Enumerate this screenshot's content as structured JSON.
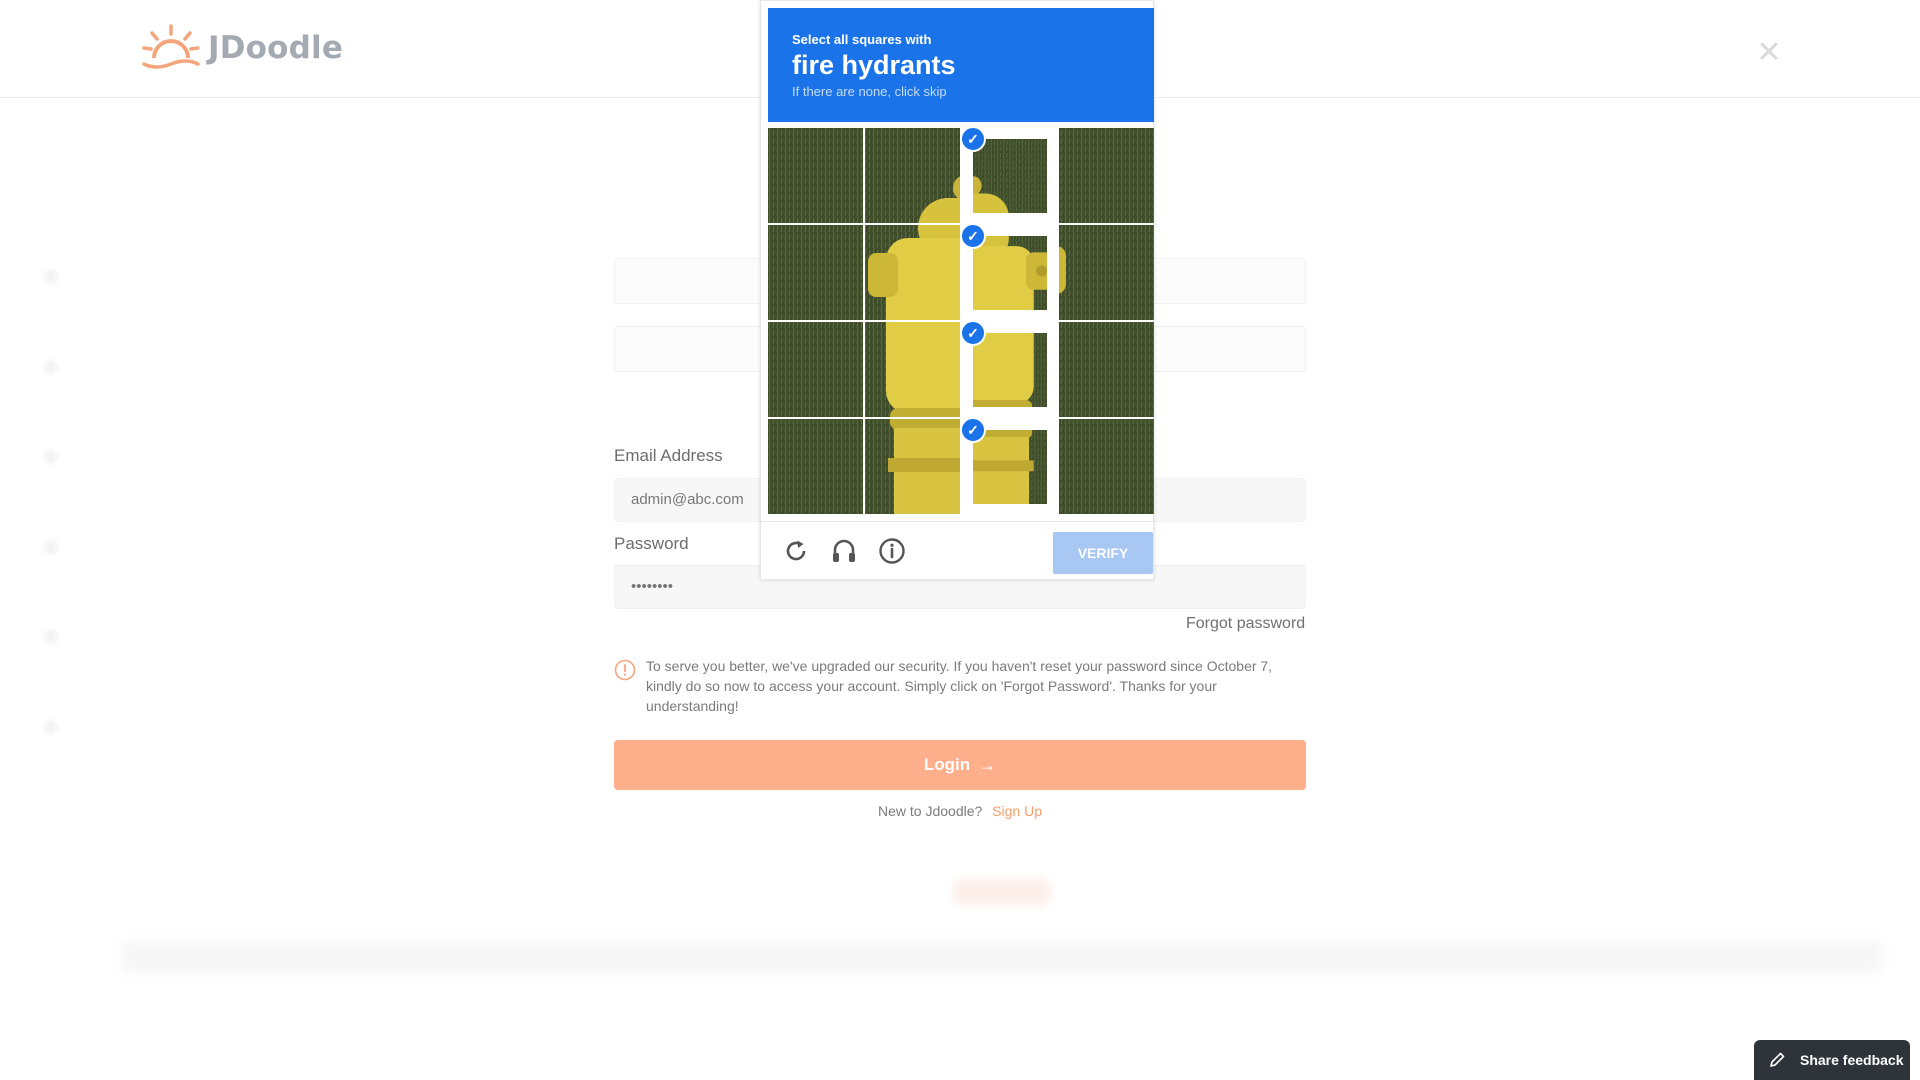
{
  "header": {
    "brand": "JDoodle",
    "close_icon": "close-icon"
  },
  "form": {
    "email_label": "Email Address",
    "email_value": "admin@abc.com",
    "password_label": "Password",
    "password_value": "••••••••",
    "forgot_link": "Forgot password",
    "notice_text": "To serve you better, we've upgraded our security. If you haven't reset your password since October 7, kindly do so now to access your account. Simply click on 'Forgot Password'. Thanks for your understanding!",
    "login_label": "Login",
    "signup_prompt": "New to Jdoodle?",
    "signup_link": "Sign Up"
  },
  "captcha": {
    "instruction": "Select all squares with",
    "target": "fire hydrants",
    "hint": "If there are none, click skip",
    "grid_size": 4,
    "selected_tiles": [
      2,
      6,
      10,
      14
    ],
    "verify_label": "VERIFY",
    "icons": [
      "refresh-icon",
      "audio-icon",
      "info-icon"
    ],
    "accent_color": "#1a73e8"
  },
  "feedback": {
    "label": "Share feedback"
  },
  "colors": {
    "brand_orange": "#f59e6b",
    "login_button": "#fdae8b"
  }
}
